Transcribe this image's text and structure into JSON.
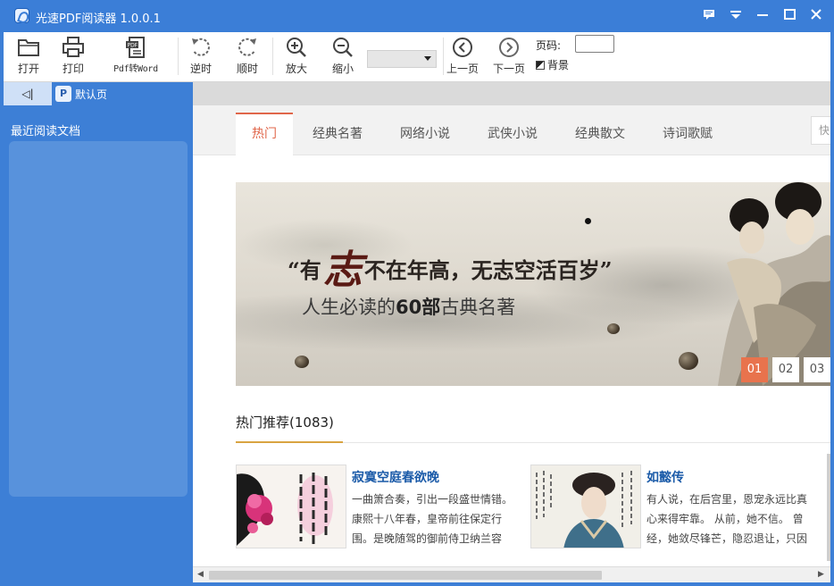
{
  "window": {
    "title": "光速PDF阅读器 1.0.0.1",
    "controls": [
      "message-icon",
      "dropdown-icon",
      "minimize-icon",
      "maximize-icon",
      "close-icon"
    ]
  },
  "toolbar": {
    "open": "打开",
    "print": "打印",
    "pdf_to_word": "Pdf转Word",
    "rotate_ccw": "逆时",
    "rotate_cw": "顺时",
    "zoom_in": "放大",
    "zoom_out": "缩小",
    "zoom_value": "",
    "prev_page": "上一页",
    "next_page": "下一页",
    "page_label": "页码:",
    "page_value": "",
    "background": "背景"
  },
  "tabs": {
    "collapse": "◁|",
    "document_tab": {
      "badge": "P",
      "label": "默认页"
    }
  },
  "sidebar": {
    "title": "最近阅读文档",
    "items": []
  },
  "categories": [
    {
      "label": "热门",
      "active": true
    },
    {
      "label": "经典名著",
      "active": false
    },
    {
      "label": "网络小说",
      "active": false
    },
    {
      "label": "武侠小说",
      "active": false
    },
    {
      "label": "经典散文",
      "active": false
    },
    {
      "label": "诗词歌赋",
      "active": false
    }
  ],
  "search": {
    "placeholder": "快"
  },
  "banner": {
    "quote_open": "“有",
    "quote_big": "志",
    "quote_rest": "不在年高，无志空活百岁”",
    "subtitle_pre": "人生必读的",
    "subtitle_bold": "60部",
    "subtitle_post": "古典名著",
    "pages": [
      "01",
      "02",
      "03"
    ],
    "active_page": "01"
  },
  "hot": {
    "title": "热门推荐(1083)",
    "books": [
      {
        "title": "寂寞空庭春欲晚",
        "desc": "一曲箫合奏，引出一段盛世情错。康熙十八年春，皇帝前往保定行围。是晚随驾的御前侍卫纳兰容"
      },
      {
        "title": "如懿传",
        "desc": "有人说，在后宫里，恩宠永远比真心来得牢靠。 从前，她不信。 曾经，她敛尽锋芒，隐忍退让，只因"
      }
    ]
  },
  "colors": {
    "chrome_blue": "#3b7ed7",
    "accent_orange": "#e0664a",
    "link_blue": "#1a5aa8",
    "gold_underline": "#d9a441"
  }
}
